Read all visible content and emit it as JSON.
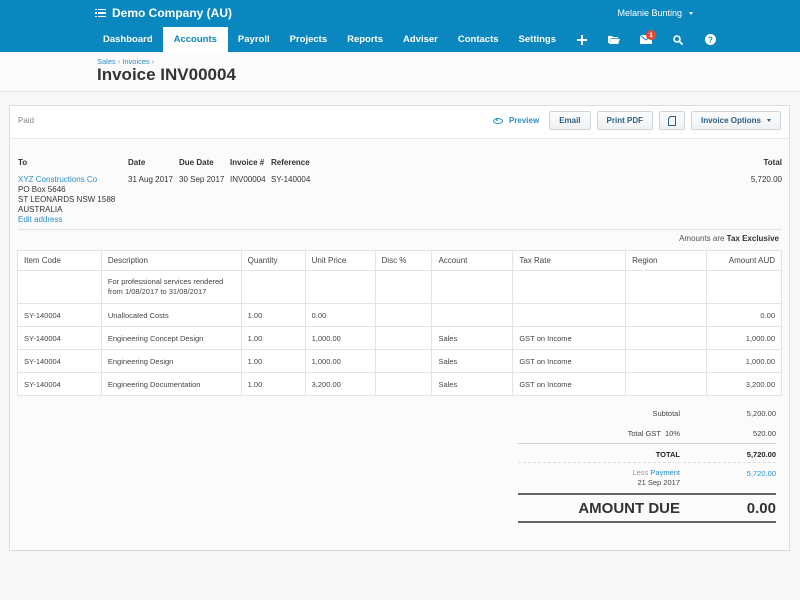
{
  "header": {
    "org_name": "Demo Company (AU)",
    "user_name": "Melanie Bunting",
    "nav_tabs": [
      {
        "label": "Dashboard",
        "active": false
      },
      {
        "label": "Accounts",
        "active": true
      },
      {
        "label": "Payroll",
        "active": false
      },
      {
        "label": "Projects",
        "active": false
      },
      {
        "label": "Reports",
        "active": false
      },
      {
        "label": "Adviser",
        "active": false
      },
      {
        "label": "Contacts",
        "active": false
      },
      {
        "label": "Settings",
        "active": false
      }
    ],
    "nav_icons": [
      "plus-icon",
      "folder-icon",
      "mail-icon",
      "search-icon",
      "help-icon"
    ],
    "mail_badge": "1",
    "colors": {
      "brand": "#0a87be",
      "link": "#2a8fcb",
      "badge": "#e34b35"
    }
  },
  "breadcrumb": {
    "items": [
      "Sales",
      "Invoices"
    ],
    "separator": "›"
  },
  "page_title": "Invoice INV00004",
  "invoice": {
    "status": "Paid",
    "actions": {
      "preview": "Preview",
      "email": "Email",
      "print_pdf": "Print PDF",
      "invoice_options": "Invoice Options"
    },
    "labels": {
      "to": "To",
      "date": "Date",
      "due_date": "Due Date",
      "invoice_no": "Invoice #",
      "reference": "Reference",
      "total": "Total"
    },
    "to": {
      "name": "XYZ Constructions Co",
      "address_line1": "PO Box 5646",
      "address_line2": "ST LEONARDS NSW 1588",
      "country": "AUSTRALIA",
      "edit_link": "Edit address"
    },
    "date": "31 Aug 2017",
    "due_date": "30 Sep 2017",
    "number": "INV00004",
    "reference": "SY-140004",
    "total": "5,720.00",
    "amounts_are_label": "Amounts are",
    "amounts_are_value": "Tax Exclusive"
  },
  "table": {
    "columns": [
      "Item Code",
      "Description",
      "Quantity",
      "Unit Price",
      "Disc %",
      "Account",
      "Tax Rate",
      "Region",
      "Amount AUD"
    ],
    "rows": [
      {
        "item_code": "",
        "description_line1": "For professional services rendered",
        "description_line2": "from 1/08/2017 to 31/08/2017",
        "quantity": "",
        "unit_price": "",
        "disc": "",
        "account": "",
        "tax_rate": "",
        "region": "",
        "amount": ""
      },
      {
        "item_code": "SY-140004",
        "description": "Unallocated Costs",
        "quantity": "1.00",
        "unit_price": "0.00",
        "disc": "",
        "account": "",
        "tax_rate": "",
        "region": "",
        "amount": "0.00"
      },
      {
        "item_code": "SY-140004",
        "description": "Engineering Concept Design",
        "quantity": "1.00",
        "unit_price": "1,000.00",
        "disc": "",
        "account": "Sales",
        "tax_rate": "GST on Income",
        "region": "",
        "amount": "1,000.00"
      },
      {
        "item_code": "SY-140004",
        "description": "Engineering Design",
        "quantity": "1.00",
        "unit_price": "1,000.00",
        "disc": "",
        "account": "Sales",
        "tax_rate": "GST on Income",
        "region": "",
        "amount": "1,000.00"
      },
      {
        "item_code": "SY-140004",
        "description": "Engineering Documentation",
        "quantity": "1.00",
        "unit_price": "3,200.00",
        "disc": "",
        "account": "Sales",
        "tax_rate": "GST on Income",
        "region": "",
        "amount": "3,200.00"
      }
    ]
  },
  "totals": {
    "subtotal_label": "Subtotal",
    "subtotal": "5,200.00",
    "gst_label": "Total GST  10%",
    "gst": "520.00",
    "total_label": "TOTAL",
    "total": "5,720.00",
    "less_label": "Less",
    "payment_label": "Payment",
    "payment_date": "21 Sep 2017",
    "payment_amount": "5,720.00",
    "amount_due_label": "AMOUNT DUE",
    "amount_due": "0.00"
  }
}
